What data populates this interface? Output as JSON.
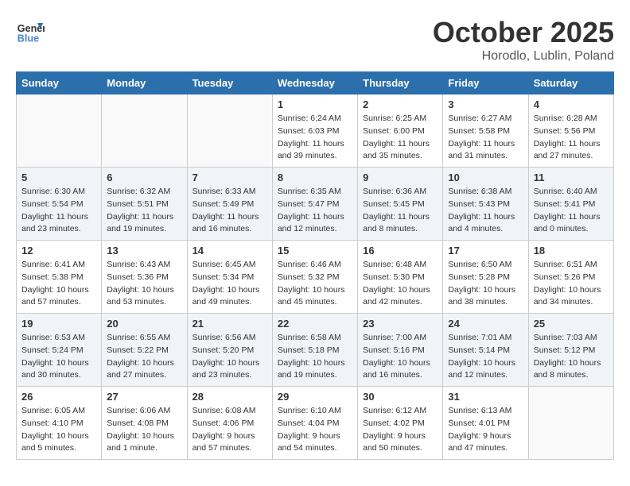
{
  "logo": {
    "general": "General",
    "blue": "Blue"
  },
  "title": "October 2025",
  "subtitle": "Horodlo, Lublin, Poland",
  "headers": [
    "Sunday",
    "Monday",
    "Tuesday",
    "Wednesday",
    "Thursday",
    "Friday",
    "Saturday"
  ],
  "weeks": [
    [
      {
        "day": "",
        "info": ""
      },
      {
        "day": "",
        "info": ""
      },
      {
        "day": "",
        "info": ""
      },
      {
        "day": "1",
        "info": "Sunrise: 6:24 AM\nSunset: 6:03 PM\nDaylight: 11 hours\nand 39 minutes."
      },
      {
        "day": "2",
        "info": "Sunrise: 6:25 AM\nSunset: 6:00 PM\nDaylight: 11 hours\nand 35 minutes."
      },
      {
        "day": "3",
        "info": "Sunrise: 6:27 AM\nSunset: 5:58 PM\nDaylight: 11 hours\nand 31 minutes."
      },
      {
        "day": "4",
        "info": "Sunrise: 6:28 AM\nSunset: 5:56 PM\nDaylight: 11 hours\nand 27 minutes."
      }
    ],
    [
      {
        "day": "5",
        "info": "Sunrise: 6:30 AM\nSunset: 5:54 PM\nDaylight: 11 hours\nand 23 minutes."
      },
      {
        "day": "6",
        "info": "Sunrise: 6:32 AM\nSunset: 5:51 PM\nDaylight: 11 hours\nand 19 minutes."
      },
      {
        "day": "7",
        "info": "Sunrise: 6:33 AM\nSunset: 5:49 PM\nDaylight: 11 hours\nand 16 minutes."
      },
      {
        "day": "8",
        "info": "Sunrise: 6:35 AM\nSunset: 5:47 PM\nDaylight: 11 hours\nand 12 minutes."
      },
      {
        "day": "9",
        "info": "Sunrise: 6:36 AM\nSunset: 5:45 PM\nDaylight: 11 hours\nand 8 minutes."
      },
      {
        "day": "10",
        "info": "Sunrise: 6:38 AM\nSunset: 5:43 PM\nDaylight: 11 hours\nand 4 minutes."
      },
      {
        "day": "11",
        "info": "Sunrise: 6:40 AM\nSunset: 5:41 PM\nDaylight: 11 hours\nand 0 minutes."
      }
    ],
    [
      {
        "day": "12",
        "info": "Sunrise: 6:41 AM\nSunset: 5:38 PM\nDaylight: 10 hours\nand 57 minutes."
      },
      {
        "day": "13",
        "info": "Sunrise: 6:43 AM\nSunset: 5:36 PM\nDaylight: 10 hours\nand 53 minutes."
      },
      {
        "day": "14",
        "info": "Sunrise: 6:45 AM\nSunset: 5:34 PM\nDaylight: 10 hours\nand 49 minutes."
      },
      {
        "day": "15",
        "info": "Sunrise: 6:46 AM\nSunset: 5:32 PM\nDaylight: 10 hours\nand 45 minutes."
      },
      {
        "day": "16",
        "info": "Sunrise: 6:48 AM\nSunset: 5:30 PM\nDaylight: 10 hours\nand 42 minutes."
      },
      {
        "day": "17",
        "info": "Sunrise: 6:50 AM\nSunset: 5:28 PM\nDaylight: 10 hours\nand 38 minutes."
      },
      {
        "day": "18",
        "info": "Sunrise: 6:51 AM\nSunset: 5:26 PM\nDaylight: 10 hours\nand 34 minutes."
      }
    ],
    [
      {
        "day": "19",
        "info": "Sunrise: 6:53 AM\nSunset: 5:24 PM\nDaylight: 10 hours\nand 30 minutes."
      },
      {
        "day": "20",
        "info": "Sunrise: 6:55 AM\nSunset: 5:22 PM\nDaylight: 10 hours\nand 27 minutes."
      },
      {
        "day": "21",
        "info": "Sunrise: 6:56 AM\nSunset: 5:20 PM\nDaylight: 10 hours\nand 23 minutes."
      },
      {
        "day": "22",
        "info": "Sunrise: 6:58 AM\nSunset: 5:18 PM\nDaylight: 10 hours\nand 19 minutes."
      },
      {
        "day": "23",
        "info": "Sunrise: 7:00 AM\nSunset: 5:16 PM\nDaylight: 10 hours\nand 16 minutes."
      },
      {
        "day": "24",
        "info": "Sunrise: 7:01 AM\nSunset: 5:14 PM\nDaylight: 10 hours\nand 12 minutes."
      },
      {
        "day": "25",
        "info": "Sunrise: 7:03 AM\nSunset: 5:12 PM\nDaylight: 10 hours\nand 8 minutes."
      }
    ],
    [
      {
        "day": "26",
        "info": "Sunrise: 6:05 AM\nSunset: 4:10 PM\nDaylight: 10 hours\nand 5 minutes."
      },
      {
        "day": "27",
        "info": "Sunrise: 6:06 AM\nSunset: 4:08 PM\nDaylight: 10 hours\nand 1 minute."
      },
      {
        "day": "28",
        "info": "Sunrise: 6:08 AM\nSunset: 4:06 PM\nDaylight: 9 hours\nand 57 minutes."
      },
      {
        "day": "29",
        "info": "Sunrise: 6:10 AM\nSunset: 4:04 PM\nDaylight: 9 hours\nand 54 minutes."
      },
      {
        "day": "30",
        "info": "Sunrise: 6:12 AM\nSunset: 4:02 PM\nDaylight: 9 hours\nand 50 minutes."
      },
      {
        "day": "31",
        "info": "Sunrise: 6:13 AM\nSunset: 4:01 PM\nDaylight: 9 hours\nand 47 minutes."
      },
      {
        "day": "",
        "info": ""
      }
    ]
  ]
}
